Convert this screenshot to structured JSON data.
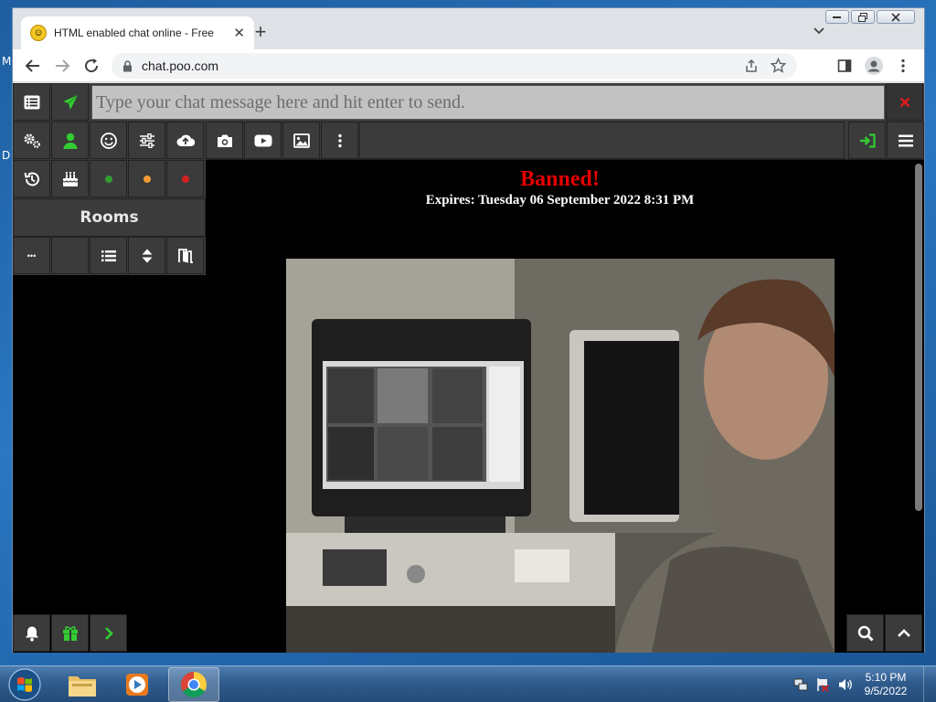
{
  "desktop": {
    "left_letters": [
      "M",
      "D"
    ]
  },
  "browser": {
    "tab": {
      "title": "HTML enabled chat online - Free",
      "favicon": "grinning-face-icon"
    },
    "url": "chat.poo.com"
  },
  "chat": {
    "input_placeholder": "Type your chat message here and hit enter to send.",
    "rooms_label": "Rooms",
    "more_dots_label": "•••",
    "banned_title": "Banned!",
    "expires_text": "Expires: Tuesday 06 September 2022 8:31 PM",
    "colors": {
      "accent_green": "#33cc33",
      "banned_red": "#e60000",
      "close_red": "#e21a1a"
    },
    "status_dots": [
      {
        "name": "online",
        "color": "#2e9e2e"
      },
      {
        "name": "away",
        "color": "#f29c38"
      },
      {
        "name": "busy",
        "color": "#d42020"
      }
    ]
  },
  "taskbar": {
    "time": "5:10 PM",
    "date": "9/5/2022",
    "apps": [
      "windows-explorer",
      "media-player",
      "google-chrome"
    ]
  }
}
